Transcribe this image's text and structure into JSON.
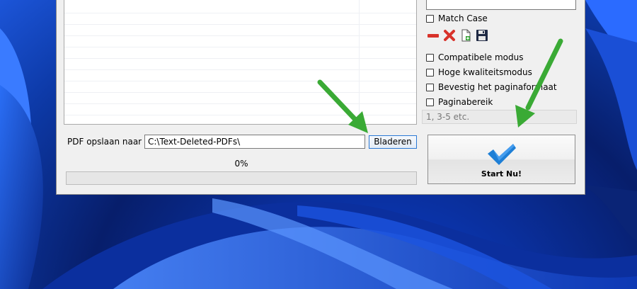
{
  "left_panel": {
    "save_label": "PDF opslaan naar",
    "save_path": "C:\\Text-Deleted-PDFs\\",
    "browse_label": "Bladeren",
    "progress_text": "0%",
    "progress_value": 0
  },
  "right_panel": {
    "match_case_label": "Match Case",
    "toolbar_icons": [
      "remove-icon",
      "delete-icon",
      "import-file-icon",
      "save-disk-icon"
    ],
    "options": [
      {
        "label": "Compatibele modus",
        "checked": false
      },
      {
        "label": "Hoge kwaliteitsmodus",
        "checked": false
      },
      {
        "label": "Bevestig het paginaformaat",
        "checked": false
      },
      {
        "label": "Paginabereik",
        "checked": false
      }
    ],
    "page_range_placeholder": "1, 3-5 etc.",
    "start_label": "Start Nu!"
  },
  "colors": {
    "annotation_arrow": "#3aaa35",
    "check_mark": "#1e7fd6",
    "progress_fill": "#06b025"
  }
}
